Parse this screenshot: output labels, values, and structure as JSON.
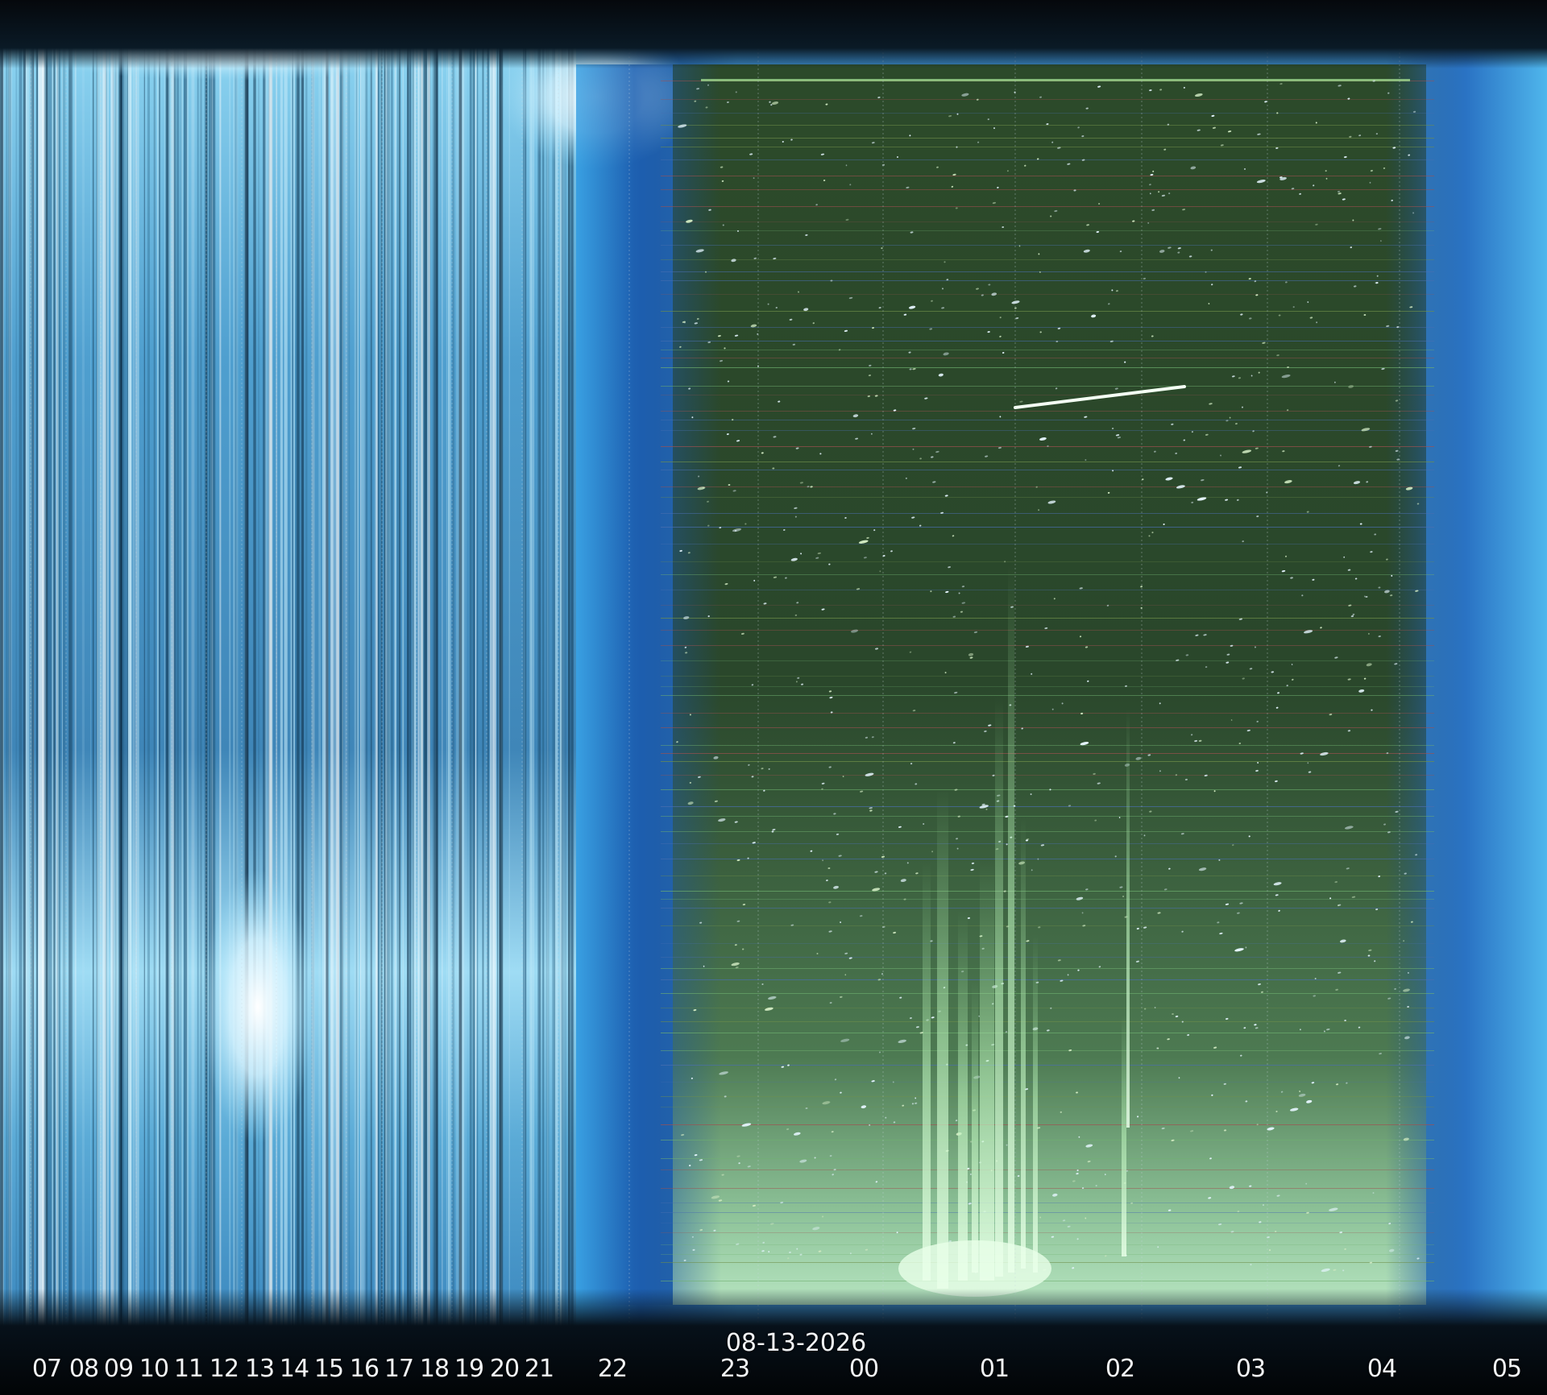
{
  "image": {
    "kind": "keogram",
    "colors": {
      "day_sky": "#5fb4e0",
      "twilight_blue": "#1f64b8",
      "night_green": "#2f4a2a",
      "frame_black": "#05080c",
      "label_text": "#f2f4f6"
    }
  },
  "time_axis": {
    "date": "08-13-2026",
    "hours": [
      "07",
      "08",
      "09",
      "10",
      "11",
      "12",
      "13",
      "14",
      "15",
      "16",
      "17",
      "18",
      "19",
      "20",
      "21",
      "22",
      "23",
      "00",
      "01",
      "02",
      "03",
      "04",
      "05"
    ]
  }
}
